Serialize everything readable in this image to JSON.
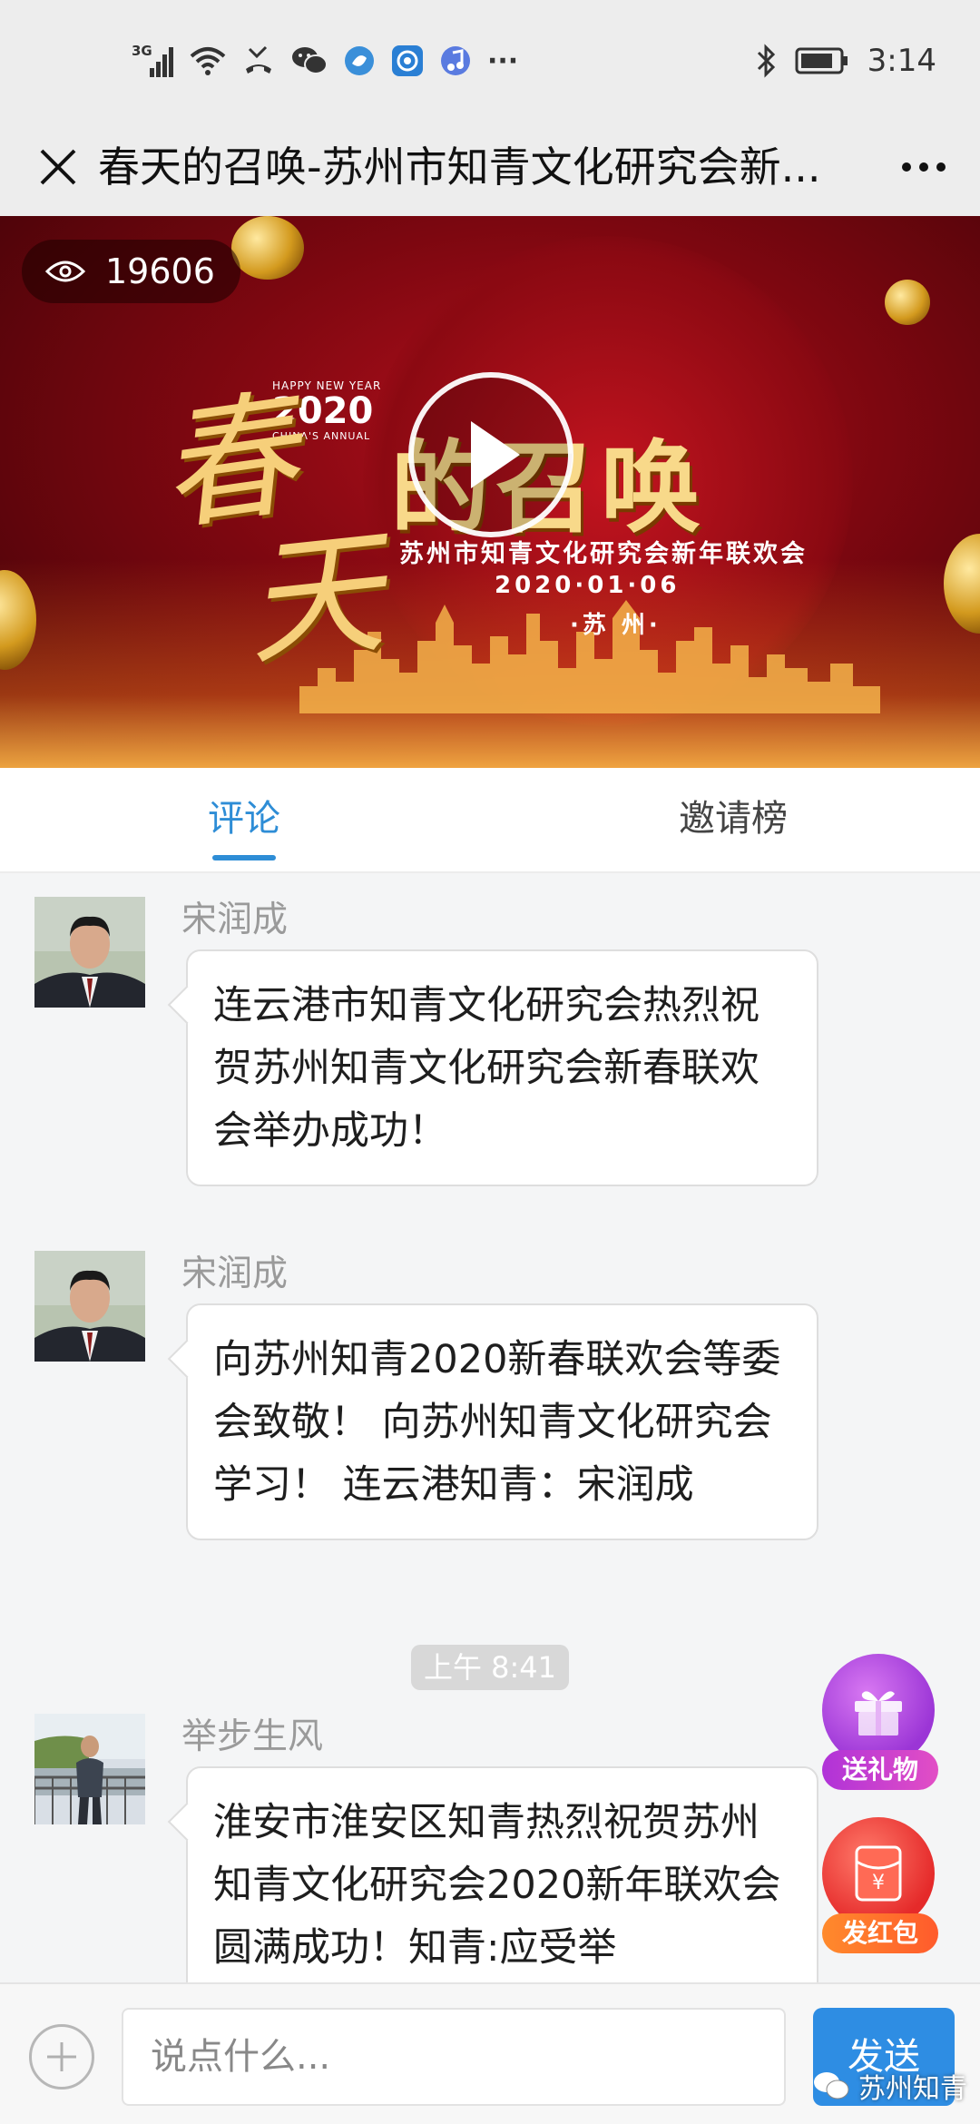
{
  "status_bar": {
    "network": "3G",
    "time": "3:14",
    "icons": [
      "signal-icon",
      "wifi-icon",
      "missed-call-icon",
      "wechat-icon",
      "app-icon-blue",
      "app-icon-shield",
      "music-icon",
      "more-icon",
      "bluetooth-icon",
      "battery-icon"
    ],
    "overflow": "···"
  },
  "titlebar": {
    "title": "春天的召唤-苏州市知青文化研究会新...",
    "close_icon": "close-icon",
    "more_icon": "more-icon"
  },
  "video": {
    "view_count": "19606",
    "view_icon": "eye-icon",
    "poster": {
      "hny_line1": "HAPPY NEW YEAR",
      "hny_year": "2020",
      "hny_line3": "CHINA'S ANNUAL",
      "char1": "春",
      "char2": "天",
      "big_title": "的召唤",
      "subtitle": "苏州市知青文化研究会新年联欢会",
      "date": "2020·01·06",
      "city": "·苏 州·"
    },
    "play_icon": "play-icon"
  },
  "tabs": [
    {
      "label": "评论",
      "active": true
    },
    {
      "label": "邀请榜",
      "active": false
    }
  ],
  "comments": [
    {
      "name": "宋润成",
      "text": "连云港市知青文化研究会热烈祝贺苏州知青文化研究会新春联欢会举办成功！"
    },
    {
      "name": "宋润成",
      "text": "向苏州知青2020新春联欢会等委会致敬！ 向苏州知青文化研究会学习！ 连云港知青：宋润成"
    },
    {
      "name": "举步生风",
      "text": "淮安市淮安区知青热烈祝贺苏州知青文化研究会2020新年联欢会圆满成功！知青:应受举"
    }
  ],
  "time_divider": "上午 8:41",
  "fabs": {
    "gift_label": "送礼物",
    "redpacket_label": "发红包",
    "redpacket_symbol": "¥"
  },
  "bottom_bar": {
    "input_placeholder": "说点什么...",
    "send_label": "发送"
  },
  "watermark": {
    "text": "苏州知青"
  },
  "colors": {
    "accent": "#2e8dd6",
    "send": "#2e8de3",
    "gift_purple": "#b24ee0",
    "redpacket_red": "#f23b3b"
  }
}
